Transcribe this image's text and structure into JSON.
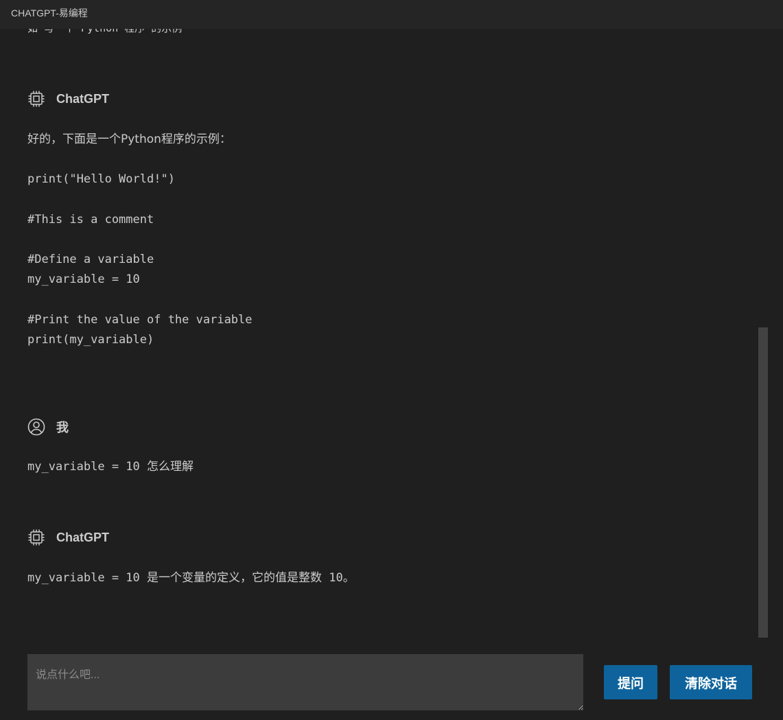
{
  "window": {
    "title": "CHATGPT-易编程"
  },
  "chat": {
    "cut_line": "如 写一个 Python 程序 的示例",
    "messages": [
      {
        "author": "ChatGPT",
        "icon": "chip-icon",
        "lines": [
          "好的，下面是一个Python程序的示例：",
          "print(\"Hello World!\")",
          "#This is a comment",
          "#Define a variable",
          "my_variable = 10",
          "#Print the value of the variable",
          "print(my_variable)"
        ]
      },
      {
        "author": "我",
        "icon": "user-icon",
        "lines": [
          "my_variable = 10 怎么理解"
        ]
      },
      {
        "author": "ChatGPT",
        "icon": "chip-icon",
        "lines": [
          "my_variable = 10 是一个变量的定义，它的值是整数 10。"
        ]
      }
    ]
  },
  "input": {
    "placeholder": "说点什么吧...",
    "value": ""
  },
  "buttons": {
    "ask": "提问",
    "clear": "清除对话"
  },
  "colors": {
    "background": "#1f1f1f",
    "titlebar": "#252526",
    "input": "#3c3c3c",
    "button": "#0e639c",
    "scrollbar": "#424242"
  }
}
